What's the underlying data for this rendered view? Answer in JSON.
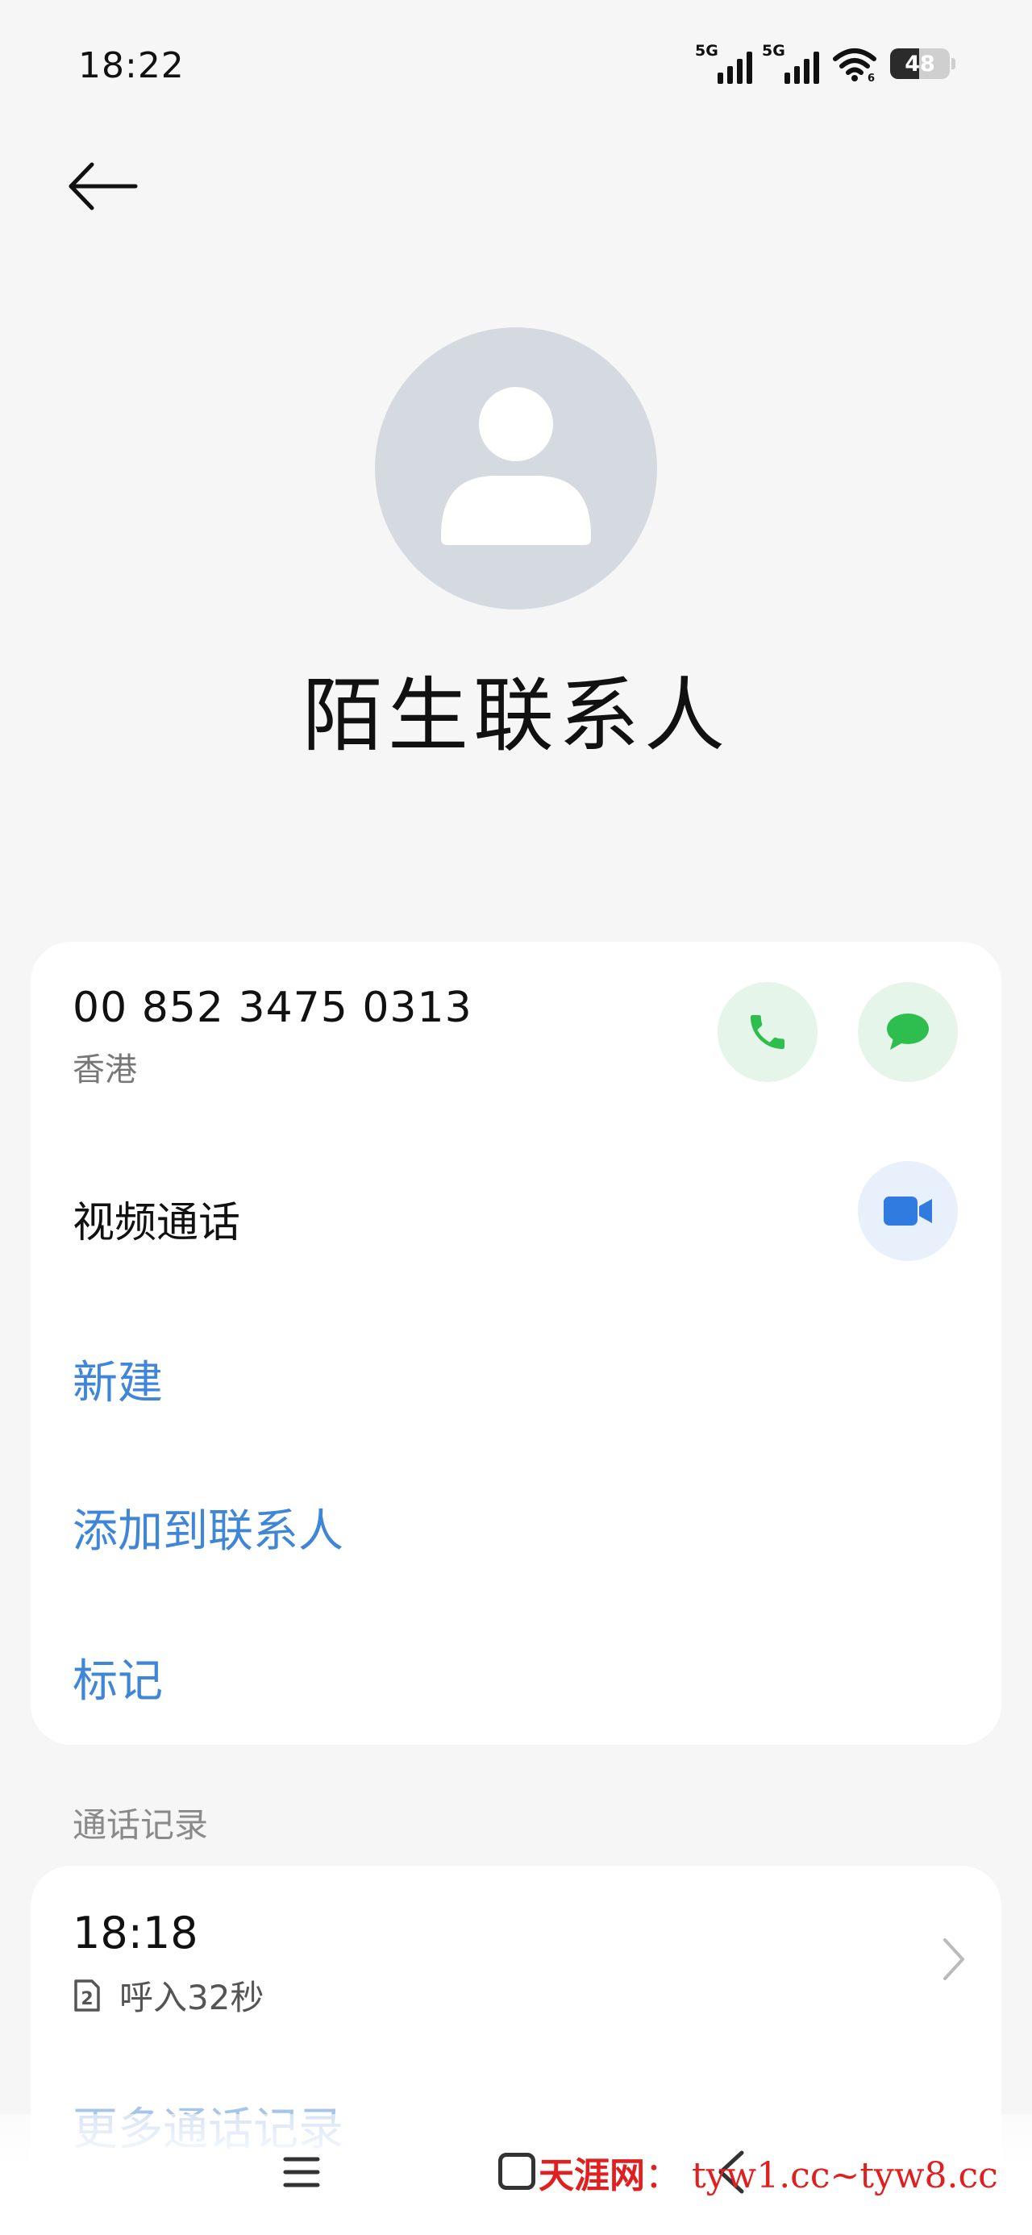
{
  "status_bar": {
    "time": "18:22",
    "network_1": "5G",
    "network_2": "5G",
    "battery_level": "48",
    "battery_fraction": 0.48,
    "icons": [
      "signal-icon",
      "signal-icon",
      "wifi-icon",
      "battery-icon"
    ]
  },
  "header": {
    "back_icon": "arrow-left-icon"
  },
  "contact": {
    "avatar_icon": "person-placeholder-icon",
    "name": "陌生联系人"
  },
  "phone": {
    "number": "00 852 3475 0313",
    "region": "香港",
    "call_icon": "phone-icon",
    "message_icon": "message-icon"
  },
  "video": {
    "label": "视频通话",
    "icon": "video-camera-icon"
  },
  "actions": {
    "new": "新建",
    "add_to_contacts": "添加到联系人",
    "mark": "标记"
  },
  "call_log": {
    "section_title": "通话记录",
    "entries": [
      {
        "time": "18:18",
        "sim": "2",
        "detail": "呼入32秒"
      }
    ],
    "more": "更多通话记录"
  },
  "nav": {
    "icons": [
      "menu-icon",
      "home-icon",
      "back-icon"
    ]
  },
  "watermark": {
    "site": "天涯网",
    "sep": "：",
    "urls": "tyw1.cc~tyw8.cc"
  },
  "colors": {
    "accent_blue": "#3f86d8",
    "call_green": "#2dbe4e",
    "video_blue": "#2f7be0",
    "background": "#f6f6f6"
  }
}
